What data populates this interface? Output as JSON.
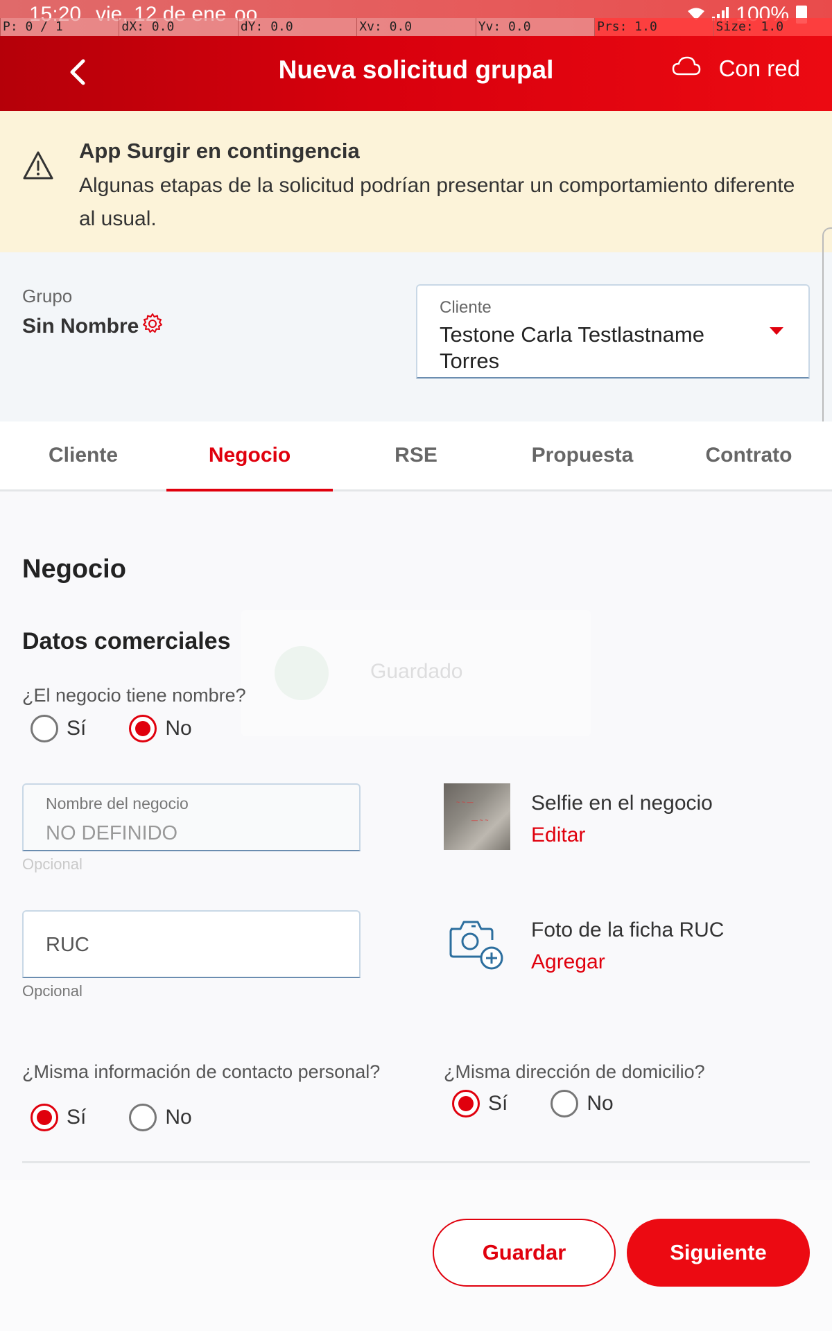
{
  "status_bar": {
    "time": "15:20",
    "date": "vie, 12 de ene",
    "infinity": "oo",
    "battery": "100%"
  },
  "debug_overlay": [
    "P: 0 / 1",
    "dX: 0.0",
    "dY: 0.0",
    "Xv: 0.0",
    "Yv: 0.0",
    "Prs: 1.0",
    "Size: 1.0"
  ],
  "app_bar": {
    "title": "Nueva solicitud grupal",
    "network_status": "Con red",
    "back_icon": "chevron-left-icon",
    "network_icon": "cloud-icon"
  },
  "banner": {
    "icon": "warning-icon",
    "title": "App Surgir en contingencia",
    "body": "Algunas etapas de la solicitud podrían presentar un comportamiento diferente al usual."
  },
  "group": {
    "label": "Grupo",
    "name": "Sin Nombre",
    "client_label": "Cliente",
    "client_value": "Testone Carla Testlastname Torres"
  },
  "tabs": [
    {
      "label": "Cliente",
      "active": false
    },
    {
      "label": "Negocio",
      "active": true
    },
    {
      "label": "RSE",
      "active": false
    },
    {
      "label": "Propuesta",
      "active": false
    },
    {
      "label": "Contrato",
      "active": false
    }
  ],
  "content": {
    "section_title": "Negocio",
    "sub_title": "Datos comerciales",
    "q_business_name": "¿El negocio tiene nombre?",
    "q_business_name_selected": "No",
    "option_yes": "Sí",
    "option_no": "No",
    "business_name_field": {
      "label": "Nombre del negocio",
      "value": "NO DEFINIDO",
      "helper": "Opcional"
    },
    "ruc_field": {
      "placeholder": "RUC",
      "helper": "Opcional"
    },
    "selfie": {
      "title": "Selfie en el negocio",
      "action": "Editar"
    },
    "ruc_photo": {
      "title": "Foto de la ficha RUC",
      "action": "Agregar"
    },
    "q_same_contact": "¿Misma información de contacto personal?",
    "q_same_contact_selected": "Sí",
    "q_same_address": "¿Misma dirección de domicilio?",
    "q_same_address_selected": "Sí"
  },
  "toast": {
    "text": "Guardado"
  },
  "footer": {
    "save_label": "Guardar",
    "next_label": "Siguiente"
  },
  "colors": {
    "brand_red": "#e0000d",
    "banner_bg": "#fcf3d9",
    "header_bg": "#f3f6f9"
  }
}
